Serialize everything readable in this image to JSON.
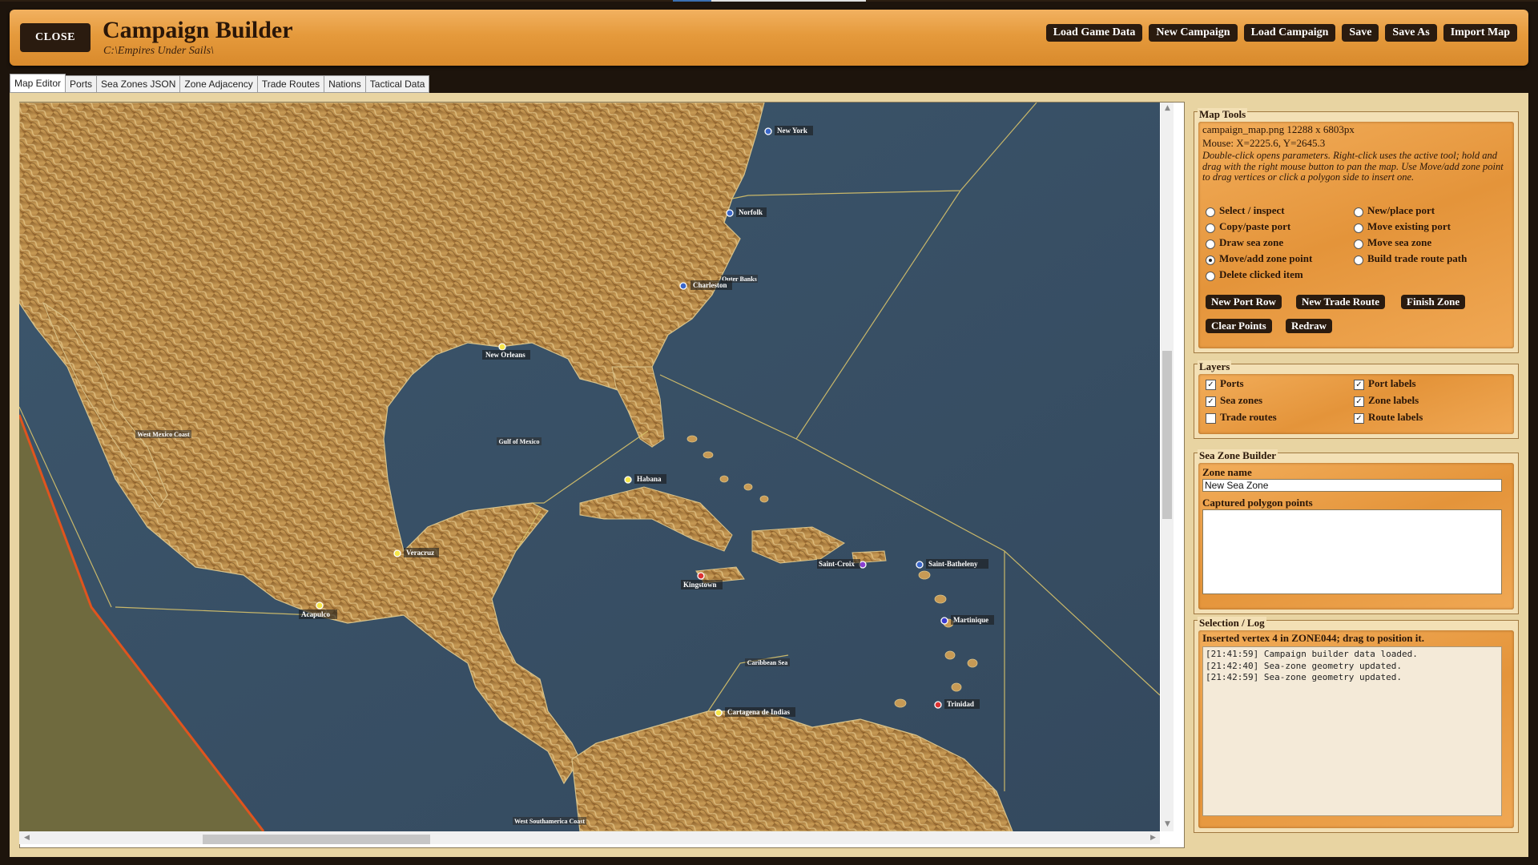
{
  "header": {
    "close_label": "CLOSE",
    "title": "Campaign Builder",
    "path": "C:\\Empires Under Sails\\",
    "buttons": [
      "Load Game Data",
      "New Campaign",
      "Load Campaign",
      "Save",
      "Save As",
      "Import Map"
    ]
  },
  "tabs": [
    "Map Editor",
    "Ports",
    "Sea Zones JSON",
    "Zone Adjacency",
    "Trade Routes",
    "Nations",
    "Tactical Data"
  ],
  "active_tab": "Map Editor",
  "map": {
    "ports": [
      {
        "name": "New York",
        "color": "#3a66c9"
      },
      {
        "name": "Norfolk",
        "color": "#3a66c9"
      },
      {
        "name": "Charleston",
        "color": "#3a66c9"
      },
      {
        "name": "New Orleans",
        "color": "#f5e64a"
      },
      {
        "name": "Habana",
        "color": "#f5e64a"
      },
      {
        "name": "Veracruz",
        "color": "#f5e64a"
      },
      {
        "name": "Acapulco",
        "color": "#f5e64a"
      },
      {
        "name": "Kingstown",
        "color": "#d33"
      },
      {
        "name": "Saint-Croix",
        "color": "#8a3fd1"
      },
      {
        "name": "Saint-Batheleny",
        "color": "#3a66c9"
      },
      {
        "name": "Martinique",
        "color": "#3a3ad1"
      },
      {
        "name": "Trinidad",
        "color": "#d33"
      },
      {
        "name": "Cartagena de Indias",
        "color": "#f5e64a"
      }
    ],
    "zone_labels": [
      "Outer Banks",
      "West Mexico Coast",
      "Gulf of Mexico",
      "Caribbean Sea",
      "West Southamerica Coast"
    ]
  },
  "map_tools": {
    "title": "Map Tools",
    "file_info": "campaign_map.png  12288 x 6803px",
    "mouse_info": "Mouse: X=2225.6, Y=2645.3",
    "help": "Double-click opens parameters. Right-click uses the active tool; hold and drag with the right mouse button to pan the map. Use Move/add zone point to drag vertices or click a polygon side to insert one.",
    "tools_left": [
      "Select / inspect",
      "Copy/paste port",
      "Draw sea zone",
      "Move/add zone point",
      "Delete clicked item"
    ],
    "tools_right": [
      "New/place port",
      "Move existing port",
      "Move sea zone",
      "Build trade route path"
    ],
    "selected_tool": "Move/add zone point",
    "buttons_row1": [
      "New Port Row",
      "New Trade Route",
      "Finish Zone"
    ],
    "buttons_row2": [
      "Clear Points",
      "Redraw"
    ]
  },
  "layers": {
    "title": "Layers",
    "left": [
      {
        "label": "Ports",
        "checked": true
      },
      {
        "label": "Sea zones",
        "checked": true
      },
      {
        "label": "Trade routes",
        "checked": false
      }
    ],
    "right": [
      {
        "label": "Port labels",
        "checked": true
      },
      {
        "label": "Zone labels",
        "checked": true
      },
      {
        "label": "Route labels",
        "checked": true
      }
    ]
  },
  "zone_builder": {
    "title": "Sea Zone Builder",
    "name_label": "Zone name",
    "name_value": "New Sea Zone",
    "points_label": "Captured polygon points",
    "points_value": ""
  },
  "selection_log": {
    "title": "Selection / Log",
    "status": "Inserted vertex 4 in ZONE044; drag to position it.",
    "entries": [
      "[21:41:59] Campaign builder data loaded.",
      "[21:42:40] Sea-zone geometry updated.",
      "[21:42:59] Sea-zone geometry updated."
    ]
  },
  "colors": {
    "header_wood": "#e59a3c",
    "button_dark": "#2a1b0f",
    "sea": "#3f5a70",
    "land": "#b88a42",
    "zone_border": "#d9c36a",
    "map_edge_line": "#e0541e"
  }
}
